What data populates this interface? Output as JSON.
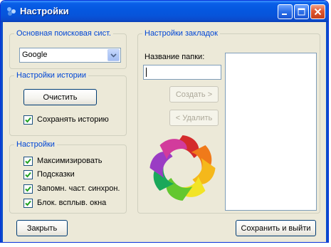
{
  "window": {
    "title": "Настройки"
  },
  "search_group": {
    "legend": "Основная поисковая сист.",
    "engine_value": "Google"
  },
  "history_group": {
    "legend": "Настройки истории",
    "clear_button": "Очистить",
    "save_history_label": "Сохранять историю",
    "save_history_checked": true
  },
  "settings_group": {
    "legend": "Настройки",
    "options": [
      {
        "label": "Максимизировать",
        "checked": true
      },
      {
        "label": "Подсказки",
        "checked": true
      },
      {
        "label": "Запомн. част. синхрон.",
        "checked": true
      },
      {
        "label": "Блок. всплыв. окна",
        "checked": true
      }
    ]
  },
  "bookmarks_group": {
    "legend": "Настройки закладок",
    "folder_name_label": "Название папки:",
    "folder_name_value": "",
    "create_button": "Создать >",
    "delete_button": "< Удалить"
  },
  "footer": {
    "close_button": "Закрыть",
    "save_exit_button": "Сохранить и выйти"
  },
  "colors": {
    "accent_legend": "#0046d5",
    "titlebar": "#0558e0",
    "window_bg": "#ece9d8"
  }
}
